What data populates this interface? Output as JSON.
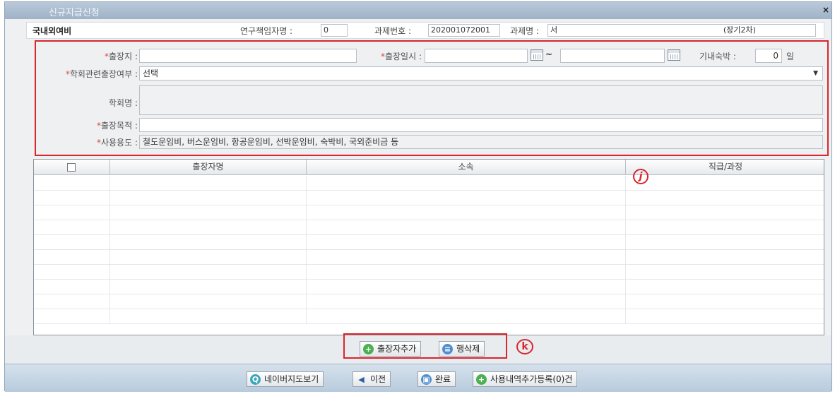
{
  "window": {
    "title": "신규지급신청",
    "close_label": "×"
  },
  "header": {
    "subtitle": "국내외여비",
    "pi_label": "연구책임자명 :",
    "pi_value": "0",
    "project_no_label": "과제번호 :",
    "project_no_value": "202001072001",
    "project_name_label": "과제명 :",
    "project_name_value": "서",
    "project_name_suffix": "(장기2차)"
  },
  "form": {
    "required_mark": "*",
    "destination_label": "출장지 :",
    "destination_value": "",
    "date_label": "출장일시 :",
    "date_from": "",
    "date_to": "",
    "date_sep": "~",
    "inflight_label": "기내숙박 :",
    "inflight_value": "0",
    "inflight_unit": "일",
    "conference_label": "학회관련출장여부 :",
    "conference_value": "선택",
    "society_label": "학회명 :",
    "society_value": "",
    "purpose_label": "출장목적 :",
    "purpose_value": "",
    "usage_label": "사용용도 :",
    "usage_value": "철도운임비, 버스운임비, 항공운임비, 선박운임비, 숙박비, 국외준비금 등"
  },
  "table": {
    "columns": [
      "",
      "출장자명",
      "소속",
      "직급/과정"
    ],
    "rows": []
  },
  "annotations": {
    "j": "j",
    "k": "k"
  },
  "table_buttons": {
    "add_traveler": "출장자추가",
    "delete_row": "행삭제"
  },
  "footer_buttons": {
    "naver_map": "네이버지도보기",
    "prev": "이전",
    "complete": "완료",
    "add_usage": "사용내역추가등록(0)건"
  }
}
